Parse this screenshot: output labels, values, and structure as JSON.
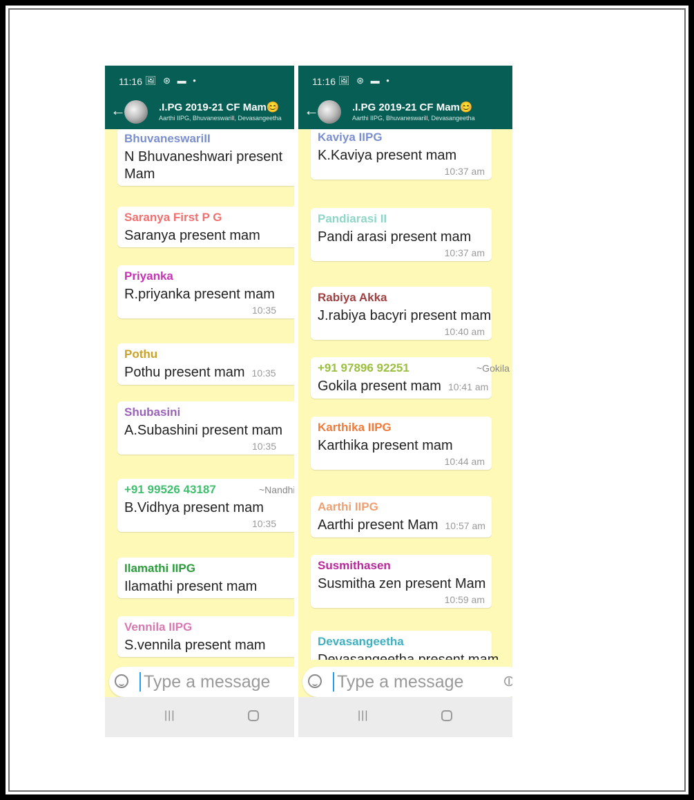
{
  "status": {
    "time": "11:16",
    "icons": "🖼 ⊛ ▬ •"
  },
  "chat_header": {
    "title": ".I.PG 2019-21 CF Mam😊",
    "subtitle": "Aarthi IIPG, Bhuvaneswarill, Devasangeetha"
  },
  "input": {
    "placeholder": "Type a message"
  },
  "left_messages": [
    {
      "sender": "BhuvaneswariII",
      "color": "#7a8fd0",
      "text": "N Bhuvaneshwari present",
      "text2": "Mam",
      "time": ""
    },
    {
      "sender": "Saranya First P G",
      "color": "#f07070",
      "text": "Saranya present mam",
      "time": ""
    },
    {
      "sender": "Priyanka",
      "color": "#c732b5",
      "text": "R.priyanka present mam",
      "time": "10:35"
    },
    {
      "sender": "Pothu",
      "color": "#c9a227",
      "text": "Pothu present mam",
      "time": "10:35"
    },
    {
      "sender": "Shubasini",
      "color": "#9a62b8",
      "text": "A.Subashini present mam",
      "time": "10:35"
    },
    {
      "sender": "+91 99526 43187",
      "alias": "~Nandhini",
      "color": "#3fbf6e",
      "text": "B.Vidhya present mam",
      "time": "10:35"
    },
    {
      "sender": "Ilamathi IIPG",
      "color": "#2b9b3c",
      "text": "Ilamathi present mam",
      "time": ""
    },
    {
      "sender": "Vennila IIPG",
      "color": "#d978b0",
      "text": "S.vennila present mam",
      "time": ""
    }
  ],
  "right_messages": [
    {
      "sender": "Kaviya IIPG",
      "color": "#7a8fd0",
      "text": "K.Kaviya present mam",
      "time": "10:37 am"
    },
    {
      "sender": "Pandiarasi II",
      "color": "#8fd6c8",
      "text": "Pandi arasi present mam",
      "time": "10:37 am"
    },
    {
      "sender": "Rabiya Akka",
      "color": "#a04040",
      "text": "J.rabiya bacyri present mam",
      "time": "10:40 am"
    },
    {
      "sender": "+91 97896 92251",
      "alias": "~Gokila",
      "color": "#9bbf3f",
      "text": "Gokila present mam",
      "time": "10:41 am"
    },
    {
      "sender": "Karthika IIPG",
      "color": "#f07a3a",
      "text": "Karthika present mam",
      "time": "10:44 am"
    },
    {
      "sender": "Aarthi IIPG",
      "color": "#f0a070",
      "text": "Aarthi present Mam",
      "time": "10:57 am"
    },
    {
      "sender": "Susmithasen",
      "color": "#b8289a",
      "text": "Susmitha zen present Mam",
      "time": "10:59 am"
    },
    {
      "sender": "Devasangeetha",
      "color": "#3fb0c0",
      "text": "Devasangeetha present mam",
      "time": ""
    }
  ]
}
